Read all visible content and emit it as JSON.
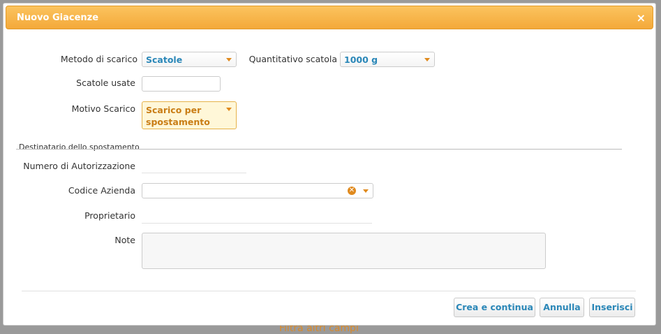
{
  "dialog": {
    "title": "Nuovo Giacenze",
    "close_label": "×"
  },
  "form": {
    "metodo_scarico": {
      "label": "Metodo di scarico",
      "value": "Scatole"
    },
    "quantitativo_scatola": {
      "label": "Quantitativo scatola",
      "value": "1000 g"
    },
    "scatole_usate": {
      "label": "Scatole usate",
      "value": ""
    },
    "motivo_scarico": {
      "label": "Motivo Scarico",
      "value": "Scarico per spostamento"
    },
    "section_title": "Destinatario dello spostamento",
    "numero_autorizzazione": {
      "label": "Numero di Autorizzazione",
      "value": ""
    },
    "codice_azienda": {
      "label": "Codice Azienda",
      "value": ""
    },
    "proprietario": {
      "label": "Proprietario",
      "value": ""
    },
    "note": {
      "label": "Note",
      "value": ""
    }
  },
  "buttons": {
    "crea_continua": "Crea e continua",
    "annulla": "Annulla",
    "inserisci": "Inserisci"
  },
  "background": {
    "partial_text": "Filtra altri campi"
  },
  "colors": {
    "accent": "#f4a93a",
    "link_blue": "#2a87b8",
    "highlight_bg": "#fff7d8"
  }
}
